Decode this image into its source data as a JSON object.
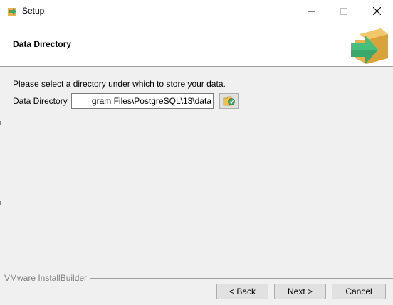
{
  "window": {
    "title": "Setup"
  },
  "header": {
    "title": "Data Directory"
  },
  "main": {
    "instruction": "Please select a directory under which to store your data.",
    "dir_label": "Data Directory",
    "dir_value": "gram Files\\PostgreSQL\\13\\data"
  },
  "footer": {
    "brand": "VMware InstallBuilder",
    "back_label": "< Back",
    "next_label": "Next >",
    "cancel_label": "Cancel"
  },
  "colors": {
    "arrow_green": "#3aa86b",
    "box_tan": "#e8b34a"
  }
}
